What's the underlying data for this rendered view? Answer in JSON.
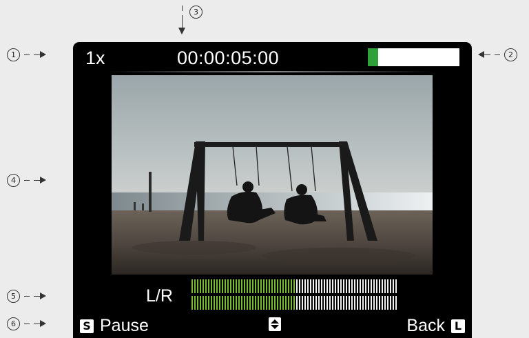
{
  "callouts": [
    "1",
    "2",
    "3",
    "4",
    "5",
    "6"
  ],
  "topbar": {
    "speed": "1x",
    "timecode": "00:00:05:00",
    "battery_level": 0.11,
    "battery_color": "#2fa03a"
  },
  "meter": {
    "label": "L/R",
    "level": 0.5,
    "active_color": "#7cbd2f",
    "inactive_color": "#f1f1f1"
  },
  "bottombar": {
    "left_key": "S",
    "left_label": "Pause",
    "nav_icon": "up-down-arrows-icon",
    "right_label": "Back",
    "right_key": "L"
  }
}
